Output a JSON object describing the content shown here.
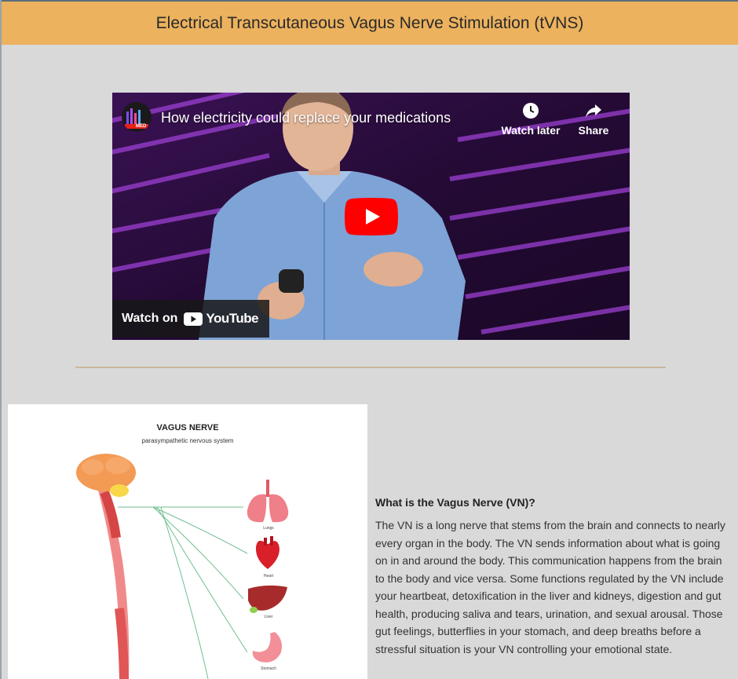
{
  "header": {
    "title": "Electrical Transcutaneous Vagus Nerve Stimulation (tVNS)"
  },
  "video": {
    "title": "How electricity could replace your medications",
    "channel_badge": "MED",
    "watch_later_label": "Watch later",
    "share_label": "Share",
    "watch_on_label": "Watch on",
    "youtube_label": "YouTube"
  },
  "diagram": {
    "title": "VAGUS NERVE",
    "subtitle": "parasympathetic nervous system",
    "organs": {
      "lungs": "Lungs",
      "heart": "Heart",
      "liver": "Liver",
      "stomach": "Stomach"
    }
  },
  "section": {
    "heading": "What is the Vagus Nerve (VN)?",
    "body": "The VN is a long nerve that stems from the brain and connects to nearly every organ in the body. The VN sends information about what is going on in and around the body. This communication happens from the brain to the body and vice versa. Some functions regulated by the VN include your heartbeat, detoxification in the liver and kidneys, digestion and gut health, producing saliva and tears, urination, and sexual arousal. Those gut feelings, butterflies in your stomach, and deep breaths before a stressful situation is your VN controlling your emotional state."
  },
  "colors": {
    "header_bg": "#ecb25e",
    "page_bg": "#d9d9d9",
    "divider": "#c9b79b",
    "youtube_red": "#ff0000"
  }
}
